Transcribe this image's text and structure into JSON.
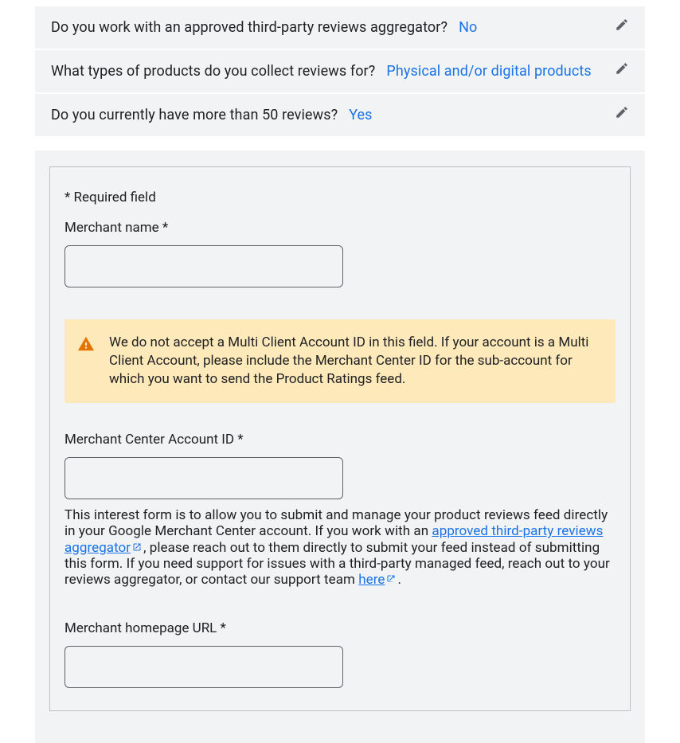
{
  "summary": [
    {
      "question": "Do you work with an approved third-party reviews aggregator?",
      "answer": "No"
    },
    {
      "question": "What types of products do you collect reviews for?",
      "answer": "Physical and/or digital products"
    },
    {
      "question": "Do you currently have more than 50 reviews?",
      "answer": "Yes"
    }
  ],
  "form": {
    "required_text": "* Required field",
    "merchant_name": {
      "label": "Merchant name  *",
      "value": ""
    },
    "alert": {
      "text": "We do not accept a Multi Client Account ID in this field. If your account is a Multi Client Account, please include the Merchant Center ID for the sub-account for which you want to send the Product Ratings feed."
    },
    "account_id": {
      "label": "Merchant Center Account ID *",
      "value": "",
      "help_pre": "This interest form is to allow you to submit and manage your product reviews feed directly in your Google Merchant Center account.  If you work with an ",
      "help_link1": "approved third-party reviews aggregator",
      "help_mid": ", please reach out to them directly to submit your feed instead of submitting this form. If you need support for issues with a third-party managed feed, reach out to your reviews aggregator, or contact our support team ",
      "help_link2": "here",
      "help_post": "."
    },
    "homepage": {
      "label": "Merchant homepage URL  *",
      "value": ""
    }
  }
}
